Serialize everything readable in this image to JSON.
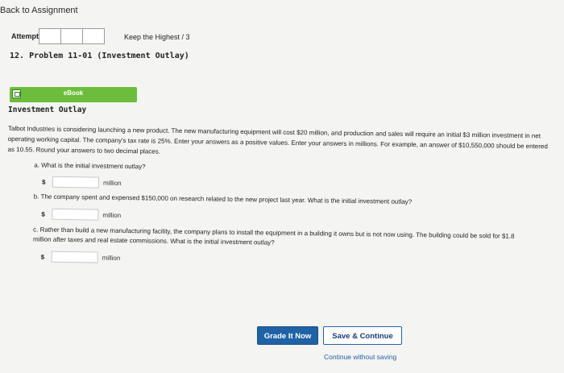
{
  "nav": {
    "back_label": "Back to Assignment"
  },
  "attempts": {
    "label": "Attempts",
    "boxes": 3,
    "keep_highest": "Keep the Highest / 3"
  },
  "problem": {
    "title": "12. Problem 11-01 (Investment Outlay)"
  },
  "ebook": {
    "label": "eBook"
  },
  "section_title": "Investment Outlay",
  "intro": "Talbot Industries is considering launching a new product. The new manufacturing equipment will cost $20 million, and production and sales will require an initial $3 million investment in net operating working capital. The company's tax rate is 25%. Enter your answers as a positive values. Enter your answers in millions. For example, an answer of $10,550,000 should be entered as 10.55. Round your answers to two decimal places.",
  "questions": [
    {
      "text": "a. What is the initial investment outlay?",
      "currency": "$",
      "value": "",
      "unit": "million"
    },
    {
      "text": "b. The company spent and expensed $150,000 on research related to the new project last year. What is the initial investment outlay?",
      "currency": "$",
      "value": "",
      "unit": "million"
    },
    {
      "text": "c. Rather than build a new manufacturing facility, the company plans to install the equipment in a building it owns but is not now using. The building could be sold for $1.8 million after taxes and real estate commissions. What is the initial investment outlay?",
      "currency": "$",
      "value": "",
      "unit": "million"
    }
  ],
  "buttons": {
    "grade": "Grade It Now",
    "save": "Save & Continue",
    "continue": "Continue without saving"
  },
  "colors": {
    "ebook_green": "#6cbd3b",
    "primary_blue": "#1f62a6",
    "link_blue": "#1f5fa8"
  }
}
